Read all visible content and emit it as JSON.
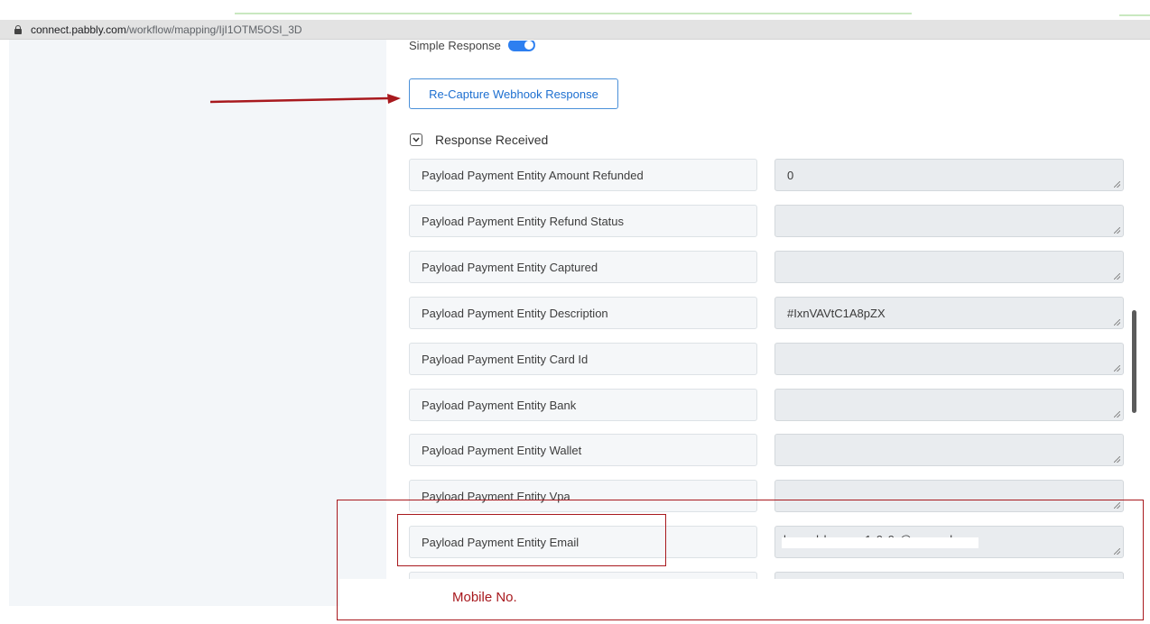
{
  "browser": {
    "url_domain": "connect.pabbly.com",
    "url_path": "/workflow/mapping/IjI1OTM5OSI_3D"
  },
  "simple_response": {
    "label": "Simple Response",
    "enabled": true
  },
  "recapture_button": {
    "label": "Re-Capture Webhook Response"
  },
  "response_section": {
    "title": "Response Received",
    "fields": [
      {
        "label": "Payload Payment Entity Amount Refunded",
        "value": "0"
      },
      {
        "label": "Payload Payment Entity Refund Status",
        "value": ""
      },
      {
        "label": "Payload Payment Entity Captured",
        "value": ""
      },
      {
        "label": "Payload Payment Entity Description",
        "value": "#IxnVAVtC1A8pZX"
      },
      {
        "label": "Payload Payment Entity Card Id",
        "value": ""
      },
      {
        "label": "Payload Payment Entity Bank",
        "value": ""
      },
      {
        "label": "Payload Payment Entity Wallet",
        "value": ""
      },
      {
        "label": "Payload Payment Entity Vpa",
        "value": ""
      },
      {
        "label": "Payload Payment Entity Email",
        "value": ""
      }
    ]
  },
  "annotation": {
    "label": "Mobile No.",
    "color": "#a8191e"
  },
  "colors": {
    "accent": "#1d6fd0",
    "annotation_red": "#a8191e"
  }
}
